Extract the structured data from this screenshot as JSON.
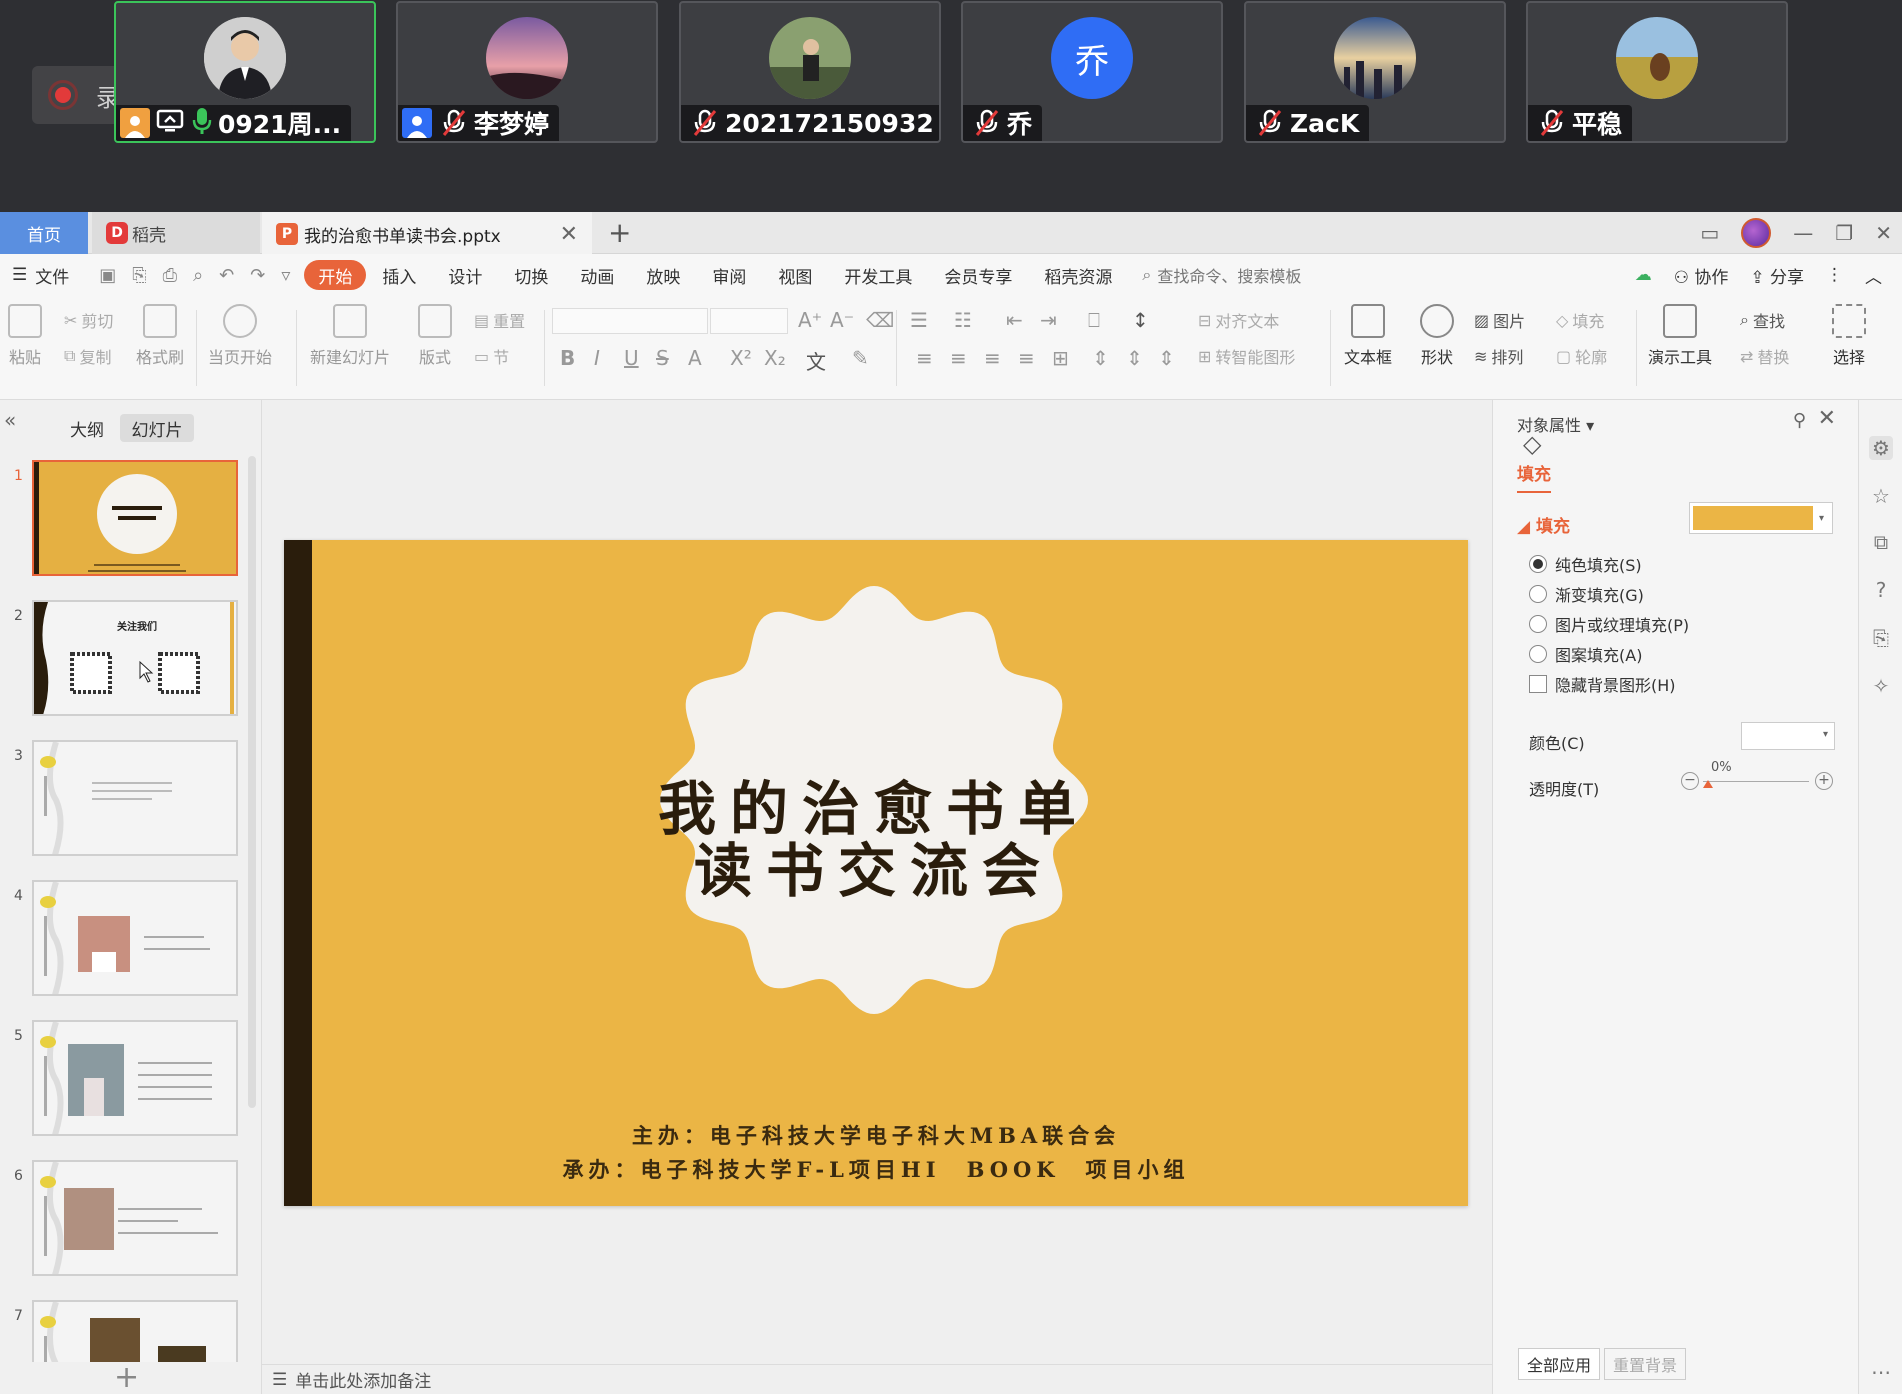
{
  "meeting": {
    "recording_label": "录制中",
    "participants": [
      {
        "name": "0921周...",
        "mic": "on",
        "active": true
      },
      {
        "name": "李梦婷",
        "mic": "muted",
        "active": false
      },
      {
        "name": "202172150932 ...",
        "mic": "muted",
        "active": false
      },
      {
        "name": "乔",
        "mic": "muted",
        "active": false,
        "initial": "乔",
        "avatar_color": "#2f6df5"
      },
      {
        "name": "ZacK",
        "mic": "muted",
        "active": false
      },
      {
        "name": "平稳",
        "mic": "muted",
        "active": false
      }
    ]
  },
  "tabs": {
    "home": "首页",
    "daoke": "稻壳",
    "doc": "我的治愈书单读书会.pptx",
    "add": "+"
  },
  "menu": {
    "file": "文件",
    "items": [
      "开始",
      "插入",
      "设计",
      "切换",
      "动画",
      "放映",
      "审阅",
      "视图",
      "开发工具",
      "会员专享",
      "稻壳资源"
    ],
    "active": "开始",
    "search_placeholder": "查找命令、搜索模板",
    "collab": "协作",
    "share": "分享"
  },
  "ribbon": {
    "paste": "粘贴",
    "cut": "剪切",
    "copy": "复制",
    "format_painter": "格式刷",
    "from_current": "当页开始",
    "new_slide": "新建幻灯片",
    "layout": "版式",
    "section": "节",
    "reset": "重置",
    "align_text": "对齐文本",
    "smart_shape": "转智能图形",
    "textbox": "文本框",
    "shape": "形状",
    "picture": "图片",
    "arrange": "排列",
    "fill": "填充",
    "outline": "轮廓",
    "present_tools": "演示工具",
    "find": "查找",
    "replace": "替换",
    "select": "选择"
  },
  "left_panel": {
    "tab_outline": "大纲",
    "tab_slides": "幻灯片",
    "slide_numbers": [
      "1",
      "2",
      "3",
      "4",
      "5",
      "6",
      "7"
    ],
    "active_slide": 1,
    "thumb2_title": "关注我们"
  },
  "slide": {
    "title_line1": "我的治愈书单",
    "title_line2": "读书交流会",
    "host": "主办：电子科技大学电子科大MBA联合会",
    "organizer": "承办：电子科技大学F-L项目HI　BOOK　项目小组",
    "bg_color": "#ebb545",
    "bar_color": "#2a1d0c"
  },
  "notes_placeholder": "单击此处添加备注",
  "right_panel": {
    "title": "对象属性",
    "fill_tab": "填充",
    "fill_section": "填充",
    "fill_color": "#ebb545",
    "options": [
      "纯色填充(S)",
      "渐变填充(G)",
      "图片或纹理填充(P)",
      "图案填充(A)"
    ],
    "selected_option": 0,
    "hide_bg": "隐藏背景图形(H)",
    "color_label": "颜色(C)",
    "transparency_label": "透明度(T)",
    "transparency_value": "0%",
    "apply_all": "全部应用",
    "reset_bg": "重置背景"
  }
}
